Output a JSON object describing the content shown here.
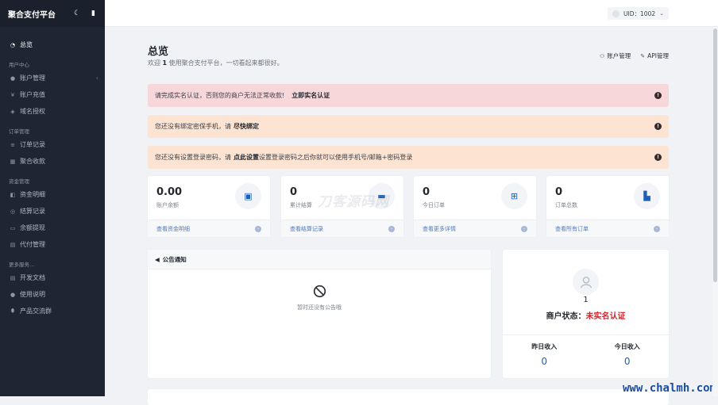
{
  "sidebar": {
    "title": "聚合支付平台",
    "moon_icon": "☾",
    "mobile_icon": "▮",
    "nav": [
      {
        "type": "item",
        "icon": "◔",
        "label": "总览",
        "active": true
      },
      {
        "type": "section",
        "label": "用户中心"
      },
      {
        "type": "item",
        "icon": "●",
        "label": "账户管理",
        "caret": "‹"
      },
      {
        "type": "item",
        "icon": "¥",
        "label": "账户充值"
      },
      {
        "type": "item",
        "icon": "◈",
        "label": "域名授权"
      },
      {
        "type": "section",
        "label": "订单管理"
      },
      {
        "type": "item",
        "icon": "≡",
        "label": "订单记录"
      },
      {
        "type": "item",
        "icon": "▦",
        "label": "聚合收款"
      },
      {
        "type": "section",
        "label": "资金管理"
      },
      {
        "type": "item",
        "icon": "◧",
        "label": "资金明细"
      },
      {
        "type": "item",
        "icon": "◎",
        "label": "结算记录"
      },
      {
        "type": "item",
        "icon": "▭",
        "label": "余额提现"
      },
      {
        "type": "item",
        "icon": "▤",
        "label": "代付管理"
      },
      {
        "type": "section",
        "label": "更多服务..."
      },
      {
        "type": "item",
        "icon": "▤",
        "label": "开发文档"
      },
      {
        "type": "item",
        "icon": "●",
        "label": "使用说明"
      },
      {
        "type": "item",
        "icon": "⬮",
        "label": "产品交流群"
      }
    ]
  },
  "topbar": {
    "uid_label": "UID：1002",
    "chevron": "⌄"
  },
  "header": {
    "title": "总览",
    "sub_pre": "欢迎 ",
    "sub_uid": "1",
    "sub_post": " 使用聚合支付平台，一切看起来都很好。",
    "links": [
      {
        "icon": "⚇",
        "label": "账户管理"
      },
      {
        "icon": "✎",
        "label": "API管理"
      }
    ]
  },
  "alerts": [
    {
      "text": "请完成实名认证，否则您的商户无法正常收款!",
      "action": "立即实名认证",
      "mark": "!"
    },
    {
      "text": "您还没有绑定密保手机，请",
      "action": "尽快绑定",
      "mark": "!"
    },
    {
      "text": "您还没有设置登录密码，请",
      "action": "点此设置",
      "tail": " 设置登录密码之后你就可以使用手机号/邮箱+密码登录",
      "mark": "!"
    }
  ],
  "stats": [
    {
      "value": "0.00",
      "label": "账户余额",
      "link": "查看资金明细",
      "icon": "▣"
    },
    {
      "value": "0",
      "label": "累计结算",
      "link": "查看结算记录",
      "icon": "▬"
    },
    {
      "value": "0",
      "label": "今日订单",
      "link": "查看更多详情",
      "icon": "⊞"
    },
    {
      "value": "0",
      "label": "订单总数",
      "link": "查看所有订单",
      "icon": "▙"
    }
  ],
  "stat_go": "›",
  "notice": {
    "icon": "◀",
    "title": "公告通知",
    "empty": "暂时还没有公告哦"
  },
  "profile": {
    "uid": "1",
    "status_label": "商户状态：",
    "status_value": "未实名认证",
    "yesterday_label": "昨日收入",
    "yesterday_value": "0",
    "today_label": "今日收入",
    "today_value": "0"
  },
  "watermark": "刀客源码网",
  "brand": "www.chalmh.com",
  "colors": {
    "sidebar": "#1e2633",
    "accent": "#1f5fb5",
    "danger": "#d9232d",
    "alert_red": "#f8d7da",
    "alert_orange": "#fde3d2"
  }
}
